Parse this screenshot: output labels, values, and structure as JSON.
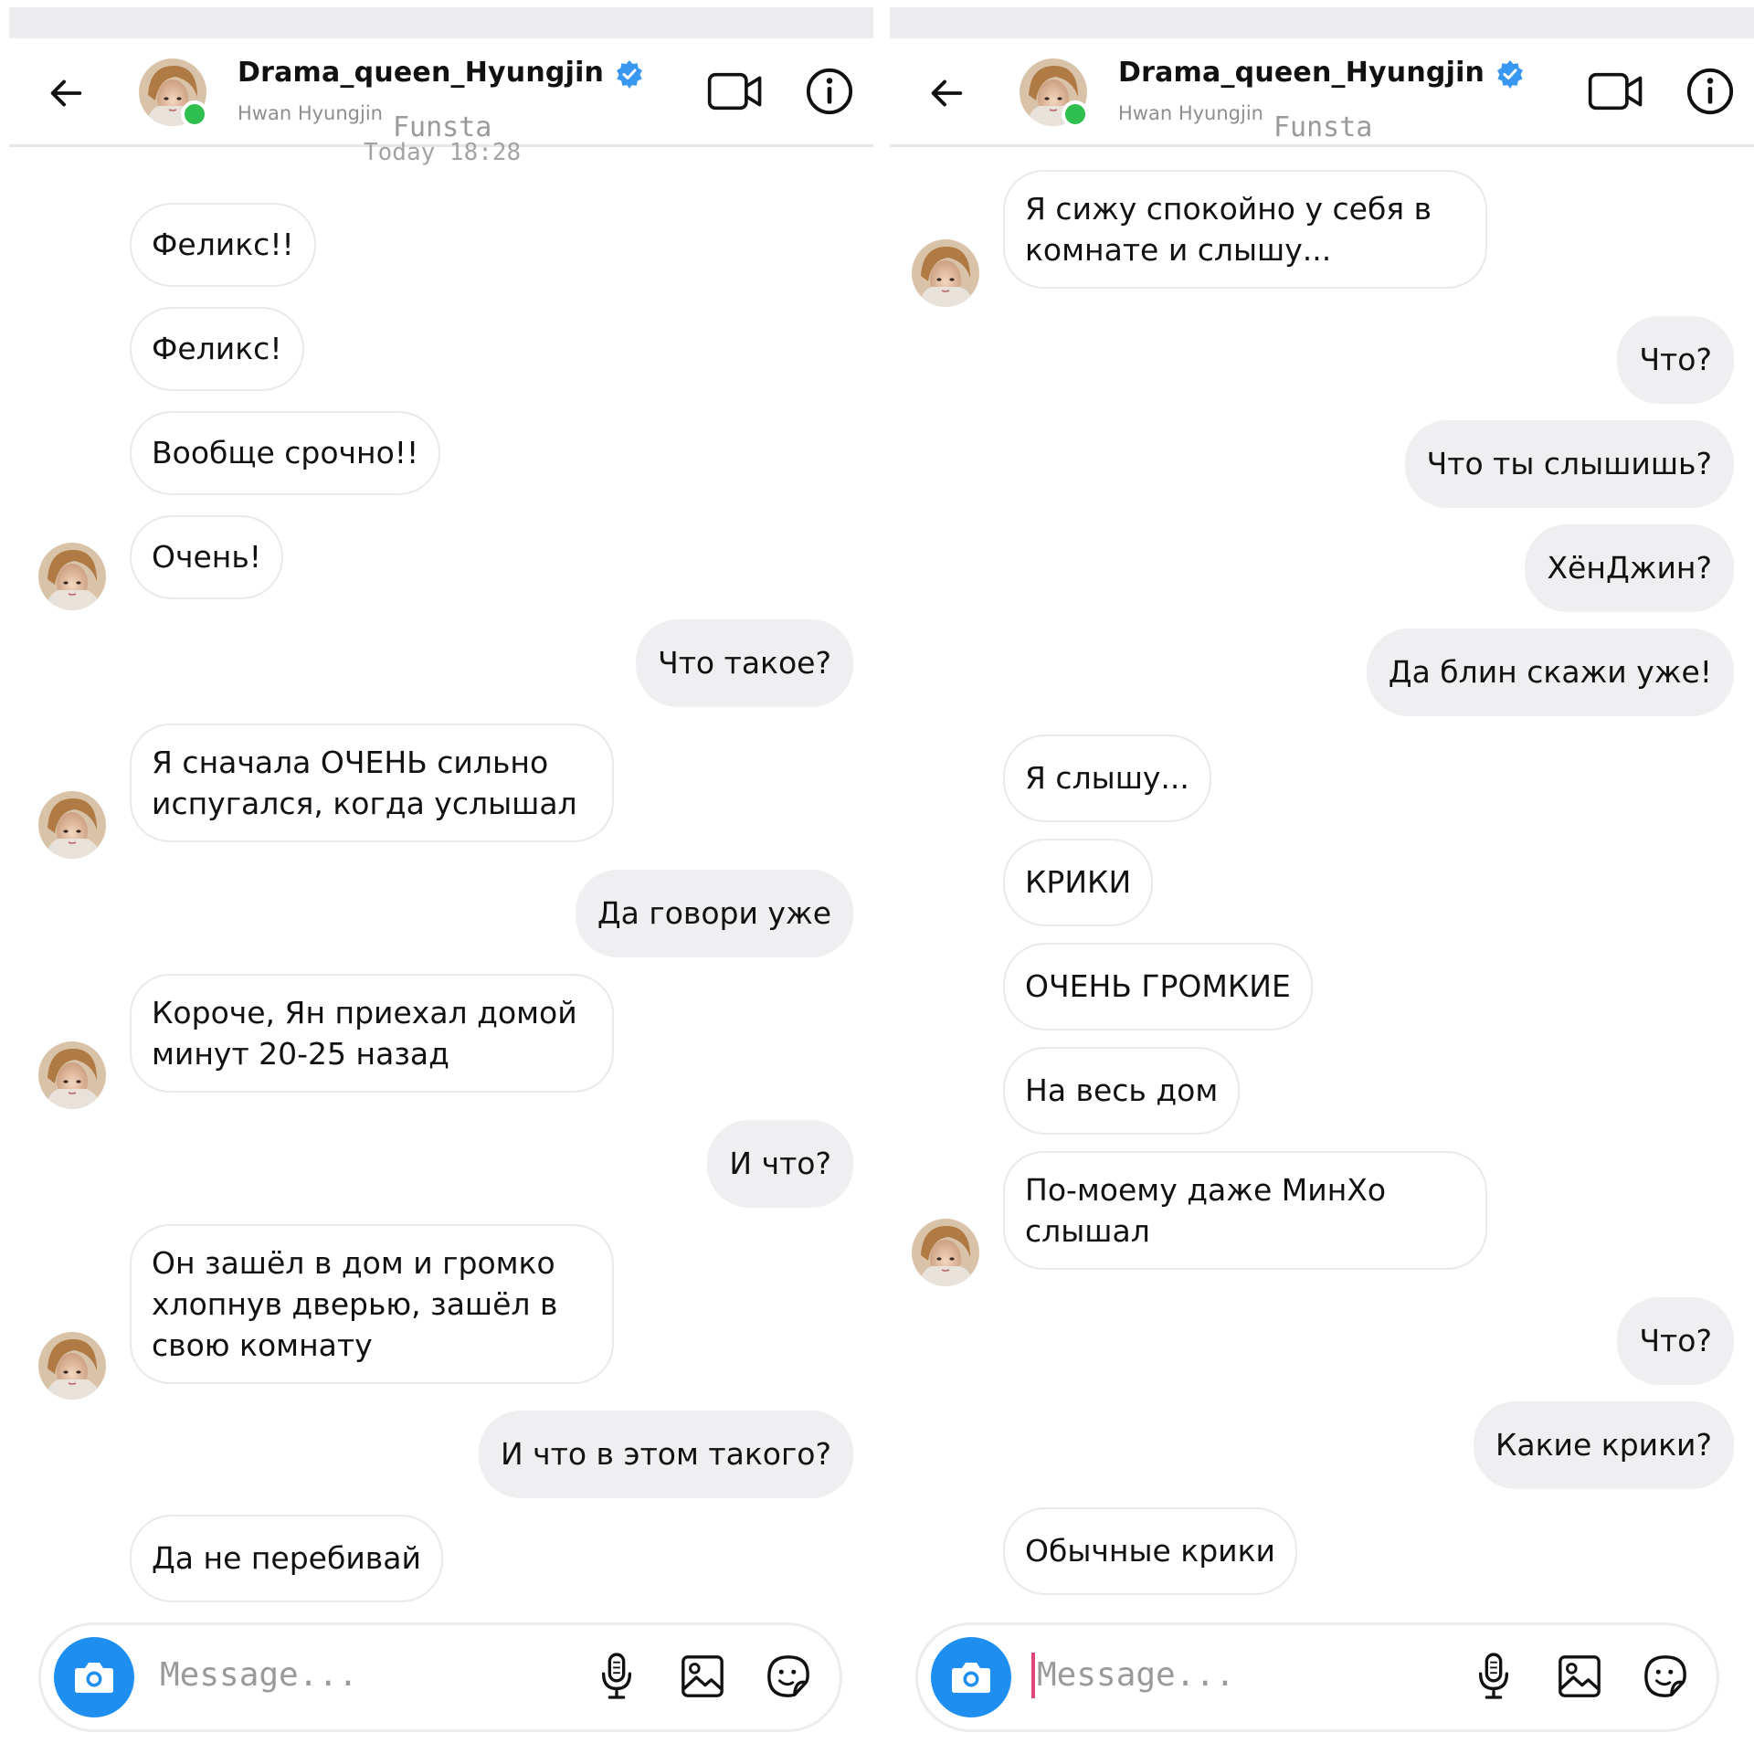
{
  "conversation": {
    "username": "Drama_queen_Hyungjin",
    "real_name": "Hwan Hyungjin",
    "tag": "Funsta",
    "timestamp": "Today 18:28",
    "placeholder": "Message..."
  },
  "colors": {
    "accent_blue": "#1e8ff0",
    "verified_blue": "#3897f0",
    "online_green": "#2fbf4f",
    "outgoing_bubble": "#efeff1",
    "caret_pink": "#e0467a"
  },
  "icons": [
    "back-arrow-icon",
    "verified-badge-icon",
    "video-call-icon",
    "info-icon",
    "camera-icon",
    "microphone-icon",
    "gallery-icon",
    "sticker-icon"
  ],
  "left_panel": {
    "messages": [
      {
        "text": "Феликс!!",
        "dir": "in"
      },
      {
        "text": "Феликс!",
        "dir": "in"
      },
      {
        "text": "Вообще срочно!!",
        "dir": "in"
      },
      {
        "text": "Очень!",
        "dir": "in"
      },
      {
        "text": "Что такое?",
        "dir": "out"
      },
      {
        "text": "Я сначала ОЧЕНЬ сильно испугался, когда услышал",
        "dir": "in"
      },
      {
        "text": "Да говори уже",
        "dir": "out"
      },
      {
        "text": "Короче, Ян приехал домой минут 20-25 назад",
        "dir": "in"
      },
      {
        "text": "И что?",
        "dir": "out"
      },
      {
        "text": "Он зашёл в дом и громко хлопнув дверью, зашёл в свою комнату",
        "dir": "in"
      },
      {
        "text": "И что в этом такого?",
        "dir": "out"
      },
      {
        "text": "Да не перебивай",
        "dir": "in"
      }
    ]
  },
  "right_panel": {
    "messages": [
      {
        "text": "Я сижу спокойно у себя в комнате и слышу...",
        "dir": "in"
      },
      {
        "text": "Что?",
        "dir": "out"
      },
      {
        "text": "Что ты слышишь?",
        "dir": "out"
      },
      {
        "text": "ХёнДжин?",
        "dir": "out"
      },
      {
        "text": "Да блин скажи уже!",
        "dir": "out"
      },
      {
        "text": "Я слышу...",
        "dir": "in"
      },
      {
        "text": "КРИКИ",
        "dir": "in"
      },
      {
        "text": "ОЧЕНЬ ГРОМКИЕ",
        "dir": "in"
      },
      {
        "text": "На весь дом",
        "dir": "in"
      },
      {
        "text": "По-моему даже МинХо слышал",
        "dir": "in"
      },
      {
        "text": "Что?",
        "dir": "out"
      },
      {
        "text": "Какие крики?",
        "dir": "out"
      },
      {
        "text": "Обычные крики",
        "dir": "in"
      }
    ]
  }
}
